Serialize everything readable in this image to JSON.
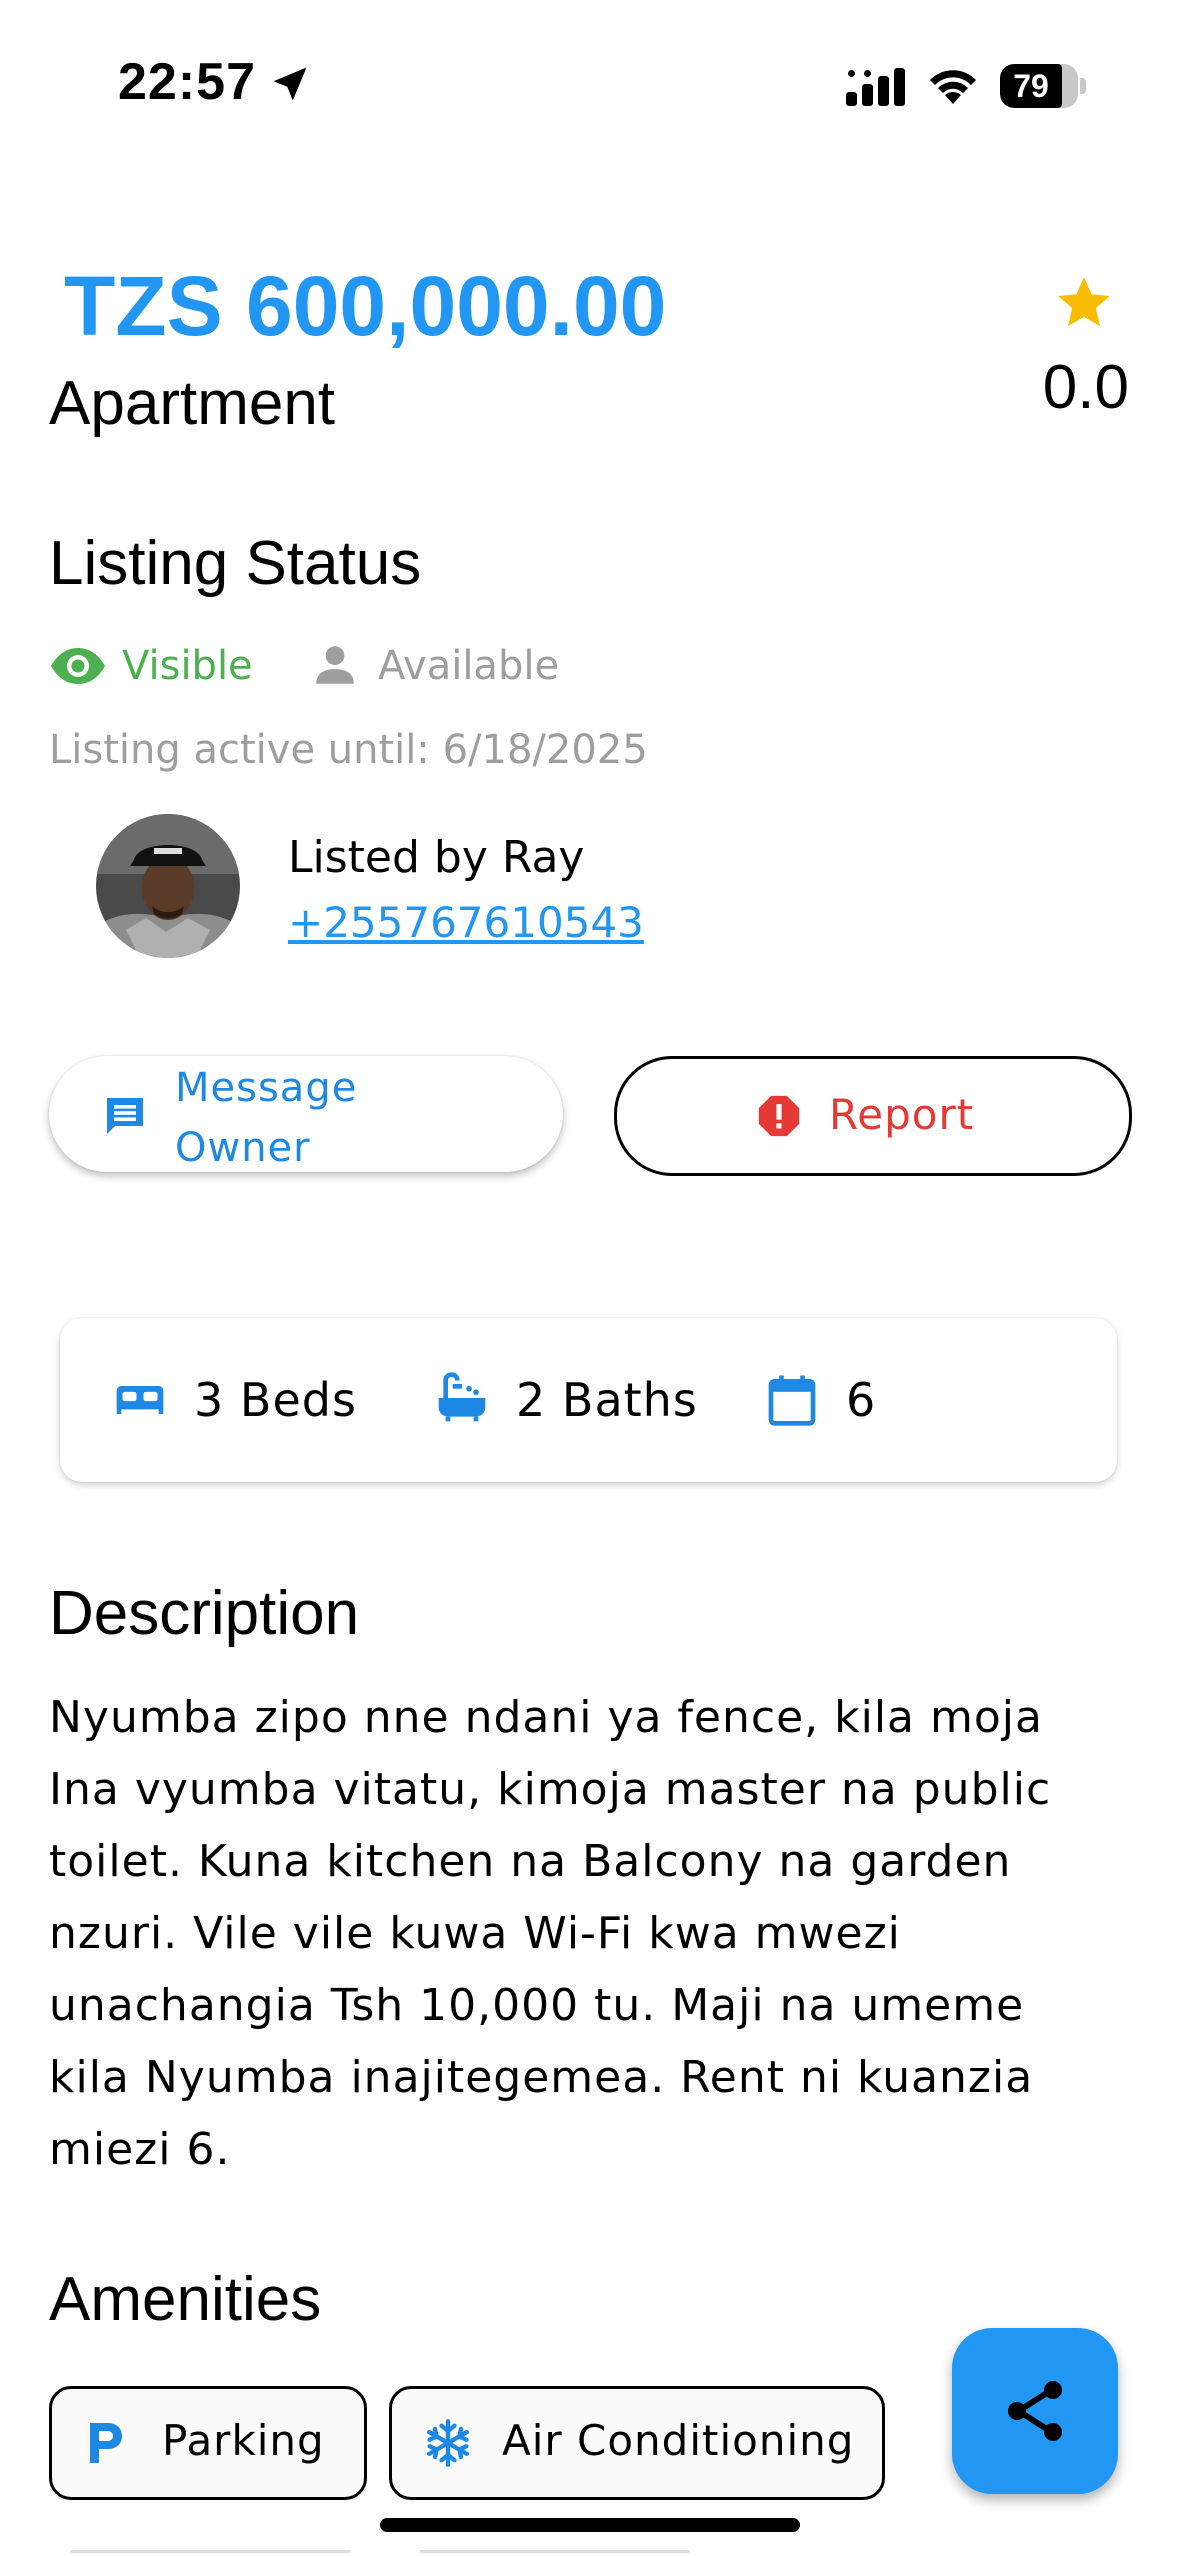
{
  "status_bar": {
    "time": "22:57",
    "battery": "79",
    "battery_level": 0.79,
    "icons": [
      "location-arrow-icon",
      "signal-icon",
      "wifi-icon",
      "battery-icon"
    ]
  },
  "listing": {
    "price": "TZS 600,000.00",
    "type": "Apartment",
    "rating": "0.0"
  },
  "listing_status": {
    "title": "Listing Status",
    "visible_label": "Visible",
    "available_label": "Available",
    "active_until": "Listing active until: 6/18/2025"
  },
  "owner": {
    "listed_by": "Listed by Ray",
    "phone": "+255767610543"
  },
  "actions": {
    "message_label": "Message Owner",
    "report_label": "Report"
  },
  "features": {
    "beds": "3 Beds",
    "baths": "2 Baths",
    "calendar": "6"
  },
  "description": {
    "title": "Description",
    "text": "Nyumba zipo nne ndani ya fence, kila moja Ina vyumba vitatu, kimoja master na public toilet. Kuna kitchen na Balcony na garden nzuri. Vile vile kuwa Wi-Fi kwa mwezi unachangia Tsh 10,000 tu. Maji na umeme kila Nyumba inajitegemea. Rent ni kuanzia miezi 6."
  },
  "amenities": {
    "title": "Amenities",
    "items": [
      {
        "label": "Parking",
        "icon": "parking-icon"
      },
      {
        "label": "Air Conditioning",
        "icon": "snowflake-icon"
      }
    ]
  },
  "colors": {
    "accent": "#2196f3",
    "visible": "#4caf50",
    "muted": "#9e9e9e",
    "report": "#e53935",
    "star": "#fbbc04"
  }
}
